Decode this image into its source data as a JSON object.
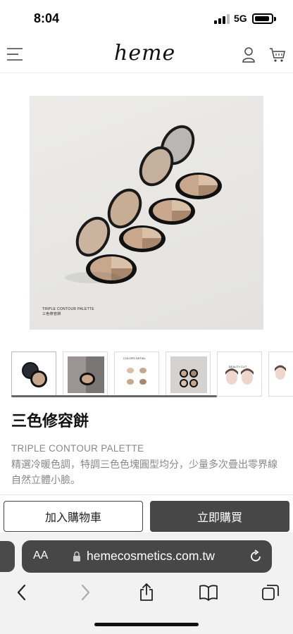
{
  "status": {
    "time": "8:04",
    "network": "5G"
  },
  "header": {
    "logo": "heme",
    "icons": [
      "menu-icon",
      "user-icon",
      "cart-icon"
    ]
  },
  "hero": {
    "caption_line1": "TRIPLE CONTOUR PALETTE",
    "caption_line2": "三色修容餅"
  },
  "thumbnails": {
    "items": [
      {
        "label": ""
      },
      {
        "label": ""
      },
      {
        "label": "COLORS DETAIL"
      },
      {
        "label": ""
      },
      {
        "label": "BEAUTY CUT"
      },
      {
        "label": ""
      }
    ]
  },
  "product": {
    "title": "三色修容餅",
    "subtitle": "TRIPLE CONTOUR PALETTE",
    "description": "精選冷暖色調，特調三色色塊圓型均分，少量多次疊出零界線自然立體小臉。"
  },
  "actions": {
    "add_to_cart": "加入購物車",
    "buy_now": "立即購買"
  },
  "browser": {
    "aa_label": "AA",
    "url": "hemecosmetics.com.tw",
    "toolbar": [
      "back-icon",
      "forward-icon",
      "share-icon",
      "bookmarks-icon",
      "tabs-icon"
    ]
  },
  "colors": {
    "button_dark": "#474747",
    "palette_shade_1": "#c9a78c",
    "palette_shade_2": "#a9876d",
    "palette_shade_3": "#d9c0a8"
  }
}
